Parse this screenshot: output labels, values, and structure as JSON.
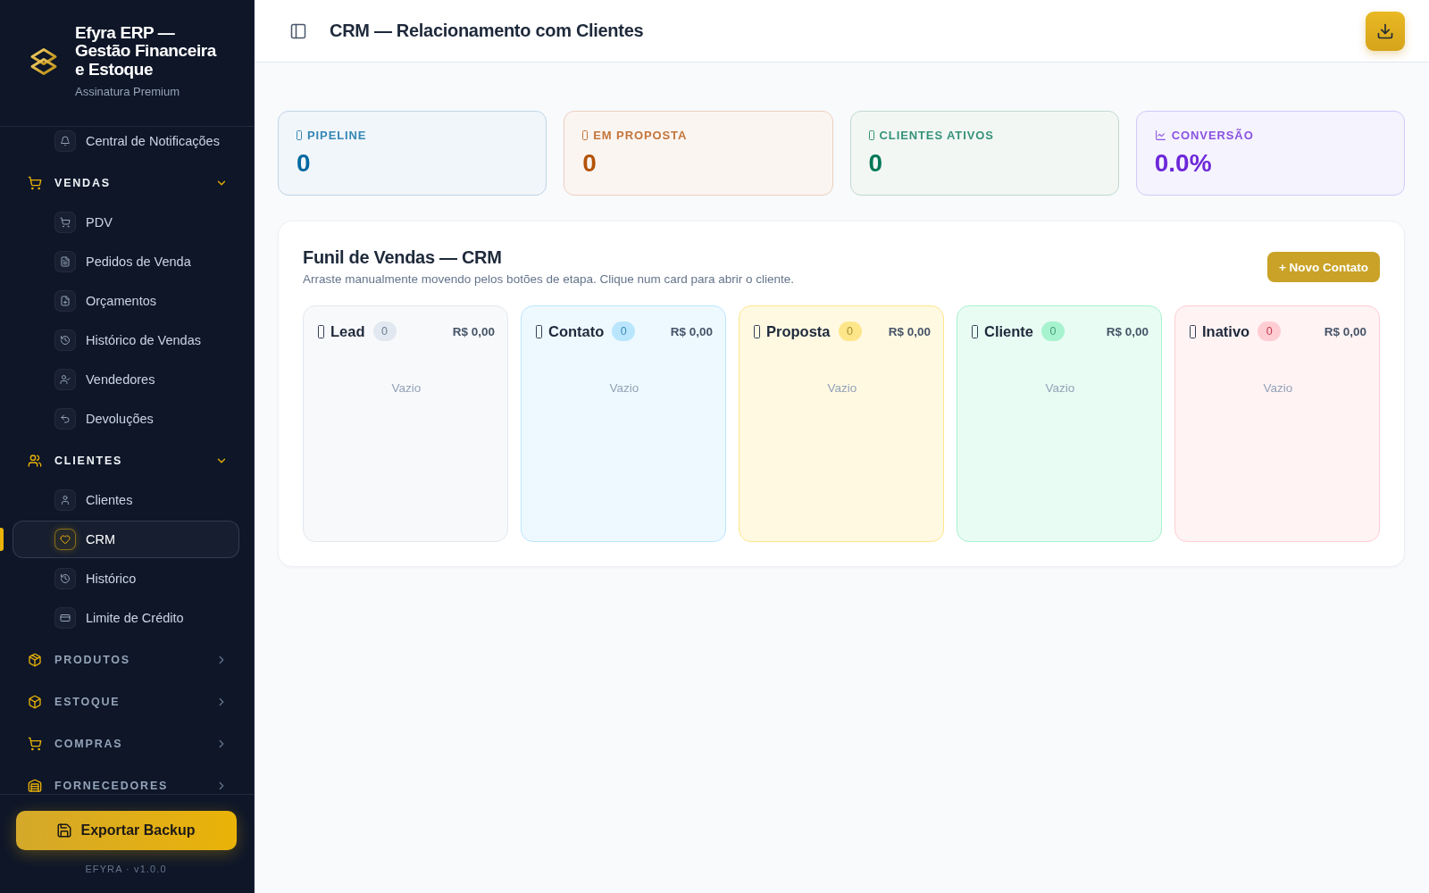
{
  "sidebar": {
    "brand": {
      "title": "Efyra ERP — Gestão Financeira e Estoque",
      "subtitle": "Assinatura Premium"
    },
    "nav": [
      {
        "kind": "item",
        "label": "Central de Notificações",
        "selected": false
      },
      {
        "kind": "section",
        "label": "VENDAS",
        "expanded": true,
        "children": [
          {
            "label": "PDV",
            "selected": false
          },
          {
            "label": "Pedidos de Venda",
            "selected": false
          },
          {
            "label": "Orçamentos",
            "selected": false
          },
          {
            "label": "Histórico de Vendas",
            "selected": false
          },
          {
            "label": "Vendedores",
            "selected": false
          },
          {
            "label": "Devoluções",
            "selected": false
          }
        ]
      },
      {
        "kind": "section",
        "label": "CLIENTES",
        "expanded": true,
        "children": [
          {
            "label": "Clientes",
            "selected": false
          },
          {
            "label": "CRM",
            "selected": true
          },
          {
            "label": "Histórico",
            "selected": false
          },
          {
            "label": "Limite de Crédito",
            "selected": false
          }
        ]
      },
      {
        "kind": "section",
        "label": "PRODUTOS",
        "expanded": false
      },
      {
        "kind": "section",
        "label": "ESTOQUE",
        "expanded": false
      },
      {
        "kind": "section",
        "label": "COMPRAS",
        "expanded": false
      },
      {
        "kind": "section",
        "label": "FORNECEDORES",
        "expanded": false
      }
    ],
    "backup_button": "Exportar Backup",
    "version": "EFYRA · v1.0.0"
  },
  "header": {
    "title": "CRM — Relacionamento com Clientes"
  },
  "stats": [
    {
      "label": "PIPELINE",
      "value": "0",
      "color": "#0369a1"
    },
    {
      "label": "EM PROPOSTA",
      "value": "0",
      "color": "#b45309"
    },
    {
      "label": "CLIENTES ATIVOS",
      "value": "0",
      "color": "#047857"
    },
    {
      "label": "CONVERSÃO",
      "value": "0.0%",
      "color": "#6d28d9"
    }
  ],
  "funnel": {
    "title": "Funil de Vendas — CRM",
    "subtitle": "Arraste manualmente movendo pelos botões de etapa. Clique num card para abrir o cliente.",
    "new_button": "+ Novo Contato",
    "columns": [
      {
        "name": "Lead",
        "count": "0",
        "total": "R$ 0,00",
        "empty_text": "Vazio",
        "color": "#e2e8f0"
      },
      {
        "name": "Contato",
        "count": "0",
        "total": "R$ 0,00",
        "empty_text": "Vazio",
        "color": "#bae6fd"
      },
      {
        "name": "Proposta",
        "count": "0",
        "total": "R$ 0,00",
        "empty_text": "Vazio",
        "color": "#fde68a"
      },
      {
        "name": "Cliente",
        "count": "0",
        "total": "R$ 0,00",
        "empty_text": "Vazio",
        "color": "#a7f3d0"
      },
      {
        "name": "Inativo",
        "count": "0",
        "total": "R$ 0,00",
        "empty_text": "Vazio",
        "color": "#fecdd3"
      }
    ]
  }
}
